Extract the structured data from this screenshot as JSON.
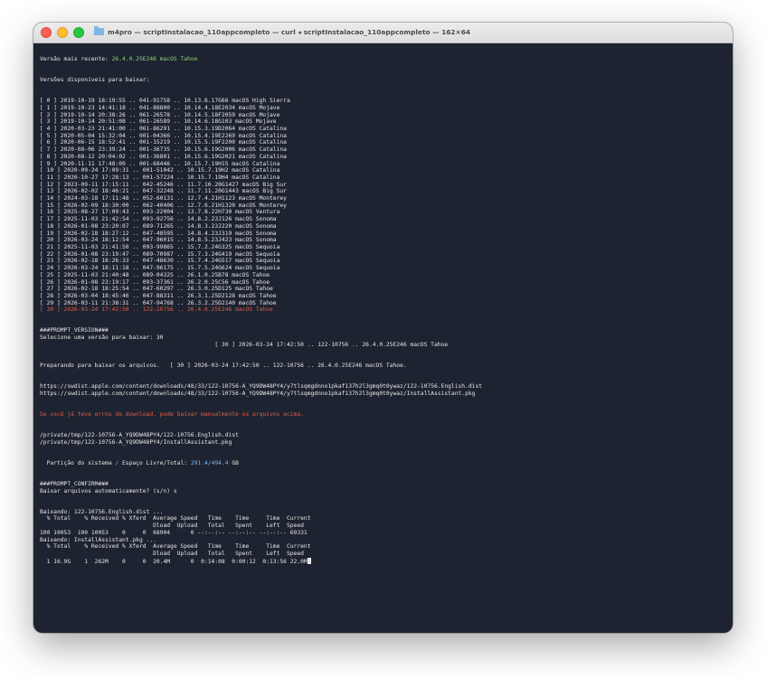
{
  "window": {
    "folder_icon": "folder-icon",
    "title": "m4pro — scriptInstalacao_110appcompleto — curl ◂ scriptInstalacao_110appcompleto — 162×64"
  },
  "colors": {
    "background": "#1d2330",
    "text": "#e6e6e6",
    "green": "#8fd17a",
    "red": "#e25c46",
    "blue": "#7cb4f0"
  },
  "terminal": {
    "latest_label": "Versão mais recente: ",
    "latest_value": "26.4.0.25E246 macOS Tahoe",
    "available_header": "Versões disponíveis para baixar:",
    "versions": [
      "[ 0 ] 2019-10-19 18:19:55 .. 041-91758 .. 10.13.6.17G66 macOS High Sierra",
      "[ 1 ] 2019-10-23 14:41:18 .. 041-88800 .. 10.14.4.18E2034 macOS Mojave",
      "[ 2 ] 2019-10-14 20:38:26 .. 061-26578 .. 10.14.5.18F2059 macOS Mojave",
      "[ 3 ] 2019-10-14 20:51:08 .. 061-26589 .. 10.14.6.18G103 macOS Mojave",
      "[ 4 ] 2020-03-23 21:41:00 .. 061-86291 .. 10.15.3.19D2064 macOS Catalina",
      "[ 5 ] 2020-05-04 15:32:04 .. 001-04366 .. 10.15.4.19E2269 macOS Catalina",
      "[ 6 ] 2020-06-15 18:52:41 .. 001-15219 .. 10.15.5.19F2200 macOS Catalina",
      "[ 7 ] 2020-08-06 23:39:24 .. 001-36735 .. 10.15.6.19G2006 macOS Catalina",
      "[ 8 ] 2020-08-12 20:04:02 .. 001-36801 .. 10.15.6.19G2021 macOS Catalina",
      "[ 9 ] 2020-11-11 17:48:09 .. 001-68446 .. 10.15.7.19H15 macOS Catalina",
      "[ 10 ] 2020-09-24 17:09:31 .. 001-51042 .. 10.15.7.19H2 macOS Catalina",
      "[ 11 ] 2020-10-27 17:28:13 .. 001-57224 .. 10.15.7.19H4 macOS Catalina",
      "[ 12 ] 2023-09-11 17:15:11 .. 042-45246 .. 11.7.10.20G1427 macOS Big Sur",
      "[ 13 ] 2026-02-02 18:46:21 .. 047-32248 .. 11.7.11.20G1443 macOS Big Sur",
      "[ 14 ] 2024-03-18 17:11:48 .. 052-60131 .. 12.7.4.21H1123 macOS Monterey",
      "[ 15 ] 2026-02-09 18:30:00 .. 062-40406 .. 12.7.6.21H1320 macOS Monterey",
      "[ 16 ] 2025-08-27 17:09:43 .. 093-22004 .. 13.7.8.22H730 macOS Ventura",
      "[ 17 ] 2025-11-03 21:42:54 .. 093-92756 .. 14.8.2.23J126 macOS Sonoma",
      "[ 18 ] 2026-01-08 23:20:07 .. 089-71265 .. 14.8.3.23J220 macOS Sonoma",
      "[ 19 ] 2026-02-18 18:27:12 .. 047-48595 .. 14.8.4.23J319 macOS Sonoma",
      "[ 20 ] 2026-03-24 18:12:54 .. 047-96015 .. 14.8.5.23J423 macOS Sonoma",
      "[ 21 ] 2025-11-03 21:41:50 .. 093-99865 .. 15.7.2.24G325 macOS Sequoia",
      "[ 22 ] 2026-01-08 23:19:47 .. 089-70987 .. 15.7.3.24G419 macOS Sequoia",
      "[ 23 ] 2026-02-18 18:26:33 .. 047-48630 .. 15.7.4.24G517 macOS Sequoia",
      "[ 24 ] 2026-03-24 18:11:18 .. 047-96175 .. 15.7.5.24G624 macOS Sequoia",
      "[ 25 ] 2025-11-03 21:40:48 .. 089-04325 .. 26.1.0.25B78 macOS Tahoe",
      "[ 26 ] 2026-01-08 23:19:17 .. 093-37361 .. 26.2.0.25C56 macOS Tahoe",
      "[ 27 ] 2026-02-18 18:25:54 .. 047-60297 .. 26.3.0.25D125 macOS Tahoe",
      "[ 28 ] 2026-03-04 18:45:46 .. 047-88311 .. 26.3.1.25D2128 macOS Tahoe",
      "[ 29 ] 2026-03-11 21:38:31 .. 047-94768 .. 26.3.2.25D2140 macOS Tahoe"
    ],
    "selected_version": "[ 30 ] 2026-03-24 17:42:50 .. 122-10756 .. 26.4.0.25E246 macOS Tahoe",
    "prompt_version_tag": "###PROMPT_VERSION###",
    "select_prompt": "Selecione uma versão para baixar: 30",
    "selected_echo": "[ 30 ] 2026-03-24 17:42:50 .. 122-10756 .. 26.4.0.25E246 macOS Tahoe",
    "preparing": "Preparando para baixar os arquivos.   [ 30 ] 2026-03-24 17:42:50 .. 122-10756 .. 26.4.0.25E246 macOS Tahoe.",
    "urls": [
      "https://swdist.apple.com/content/downloads/48/33/122-10756-A_YQ9DW48PY4/y7tlsqmgdnno1pkaf137h2l3gmq0t0ywaz/122-10756.English.dist",
      "https://swdist.apple.com/content/downloads/48/33/122-10756-A_YQ9DW48PY4/y7tlsqmgdnno1pkaf137h2l3gmq0t0ywaz/InstallAssistant.pkg"
    ],
    "error_notice": "Se você já teve erros de download, pode baixar manualmente os arquivos acima.",
    "paths": [
      "/private/tmp/122-10756-A_YQ9DW48PY4/122-10756.English.dist",
      "/private/tmp/122-10756-A_YQ9DW48PY4/InstallAssistant.pkg"
    ],
    "partition_label": "Partição do sistema",
    "partition_sep": " / ",
    "free_space_label": "Espaço Livre/Total: ",
    "free_space_value": "291.4/494.4",
    "free_space_unit": " GB",
    "prompt_confirm_tag": "###PROMPT_CONFIRM###",
    "confirm_question": "Baixar arquivos automaticamente? (s/n) s",
    "download1_label": "Baixando: 122-10756.English.dist ...",
    "curl_header1": "  % Total    % Received % Xferd  Average Speed   Time    Time     Time  Current",
    "curl_header2": "                                 Dload  Upload   Total   Spent    Left  Speed",
    "download1_progress": "100 10053  100 10053    0     0  68904      0 --:--:-- --:--:-- --:--:-- 69331",
    "download2_label": "Baixando: InstallAssistant.pkg ...",
    "download2_progress": "  1 16.9G    1  262M    0     0  20.4M      0  0:14:08  0:00:12  0:13:56 22.0M"
  }
}
